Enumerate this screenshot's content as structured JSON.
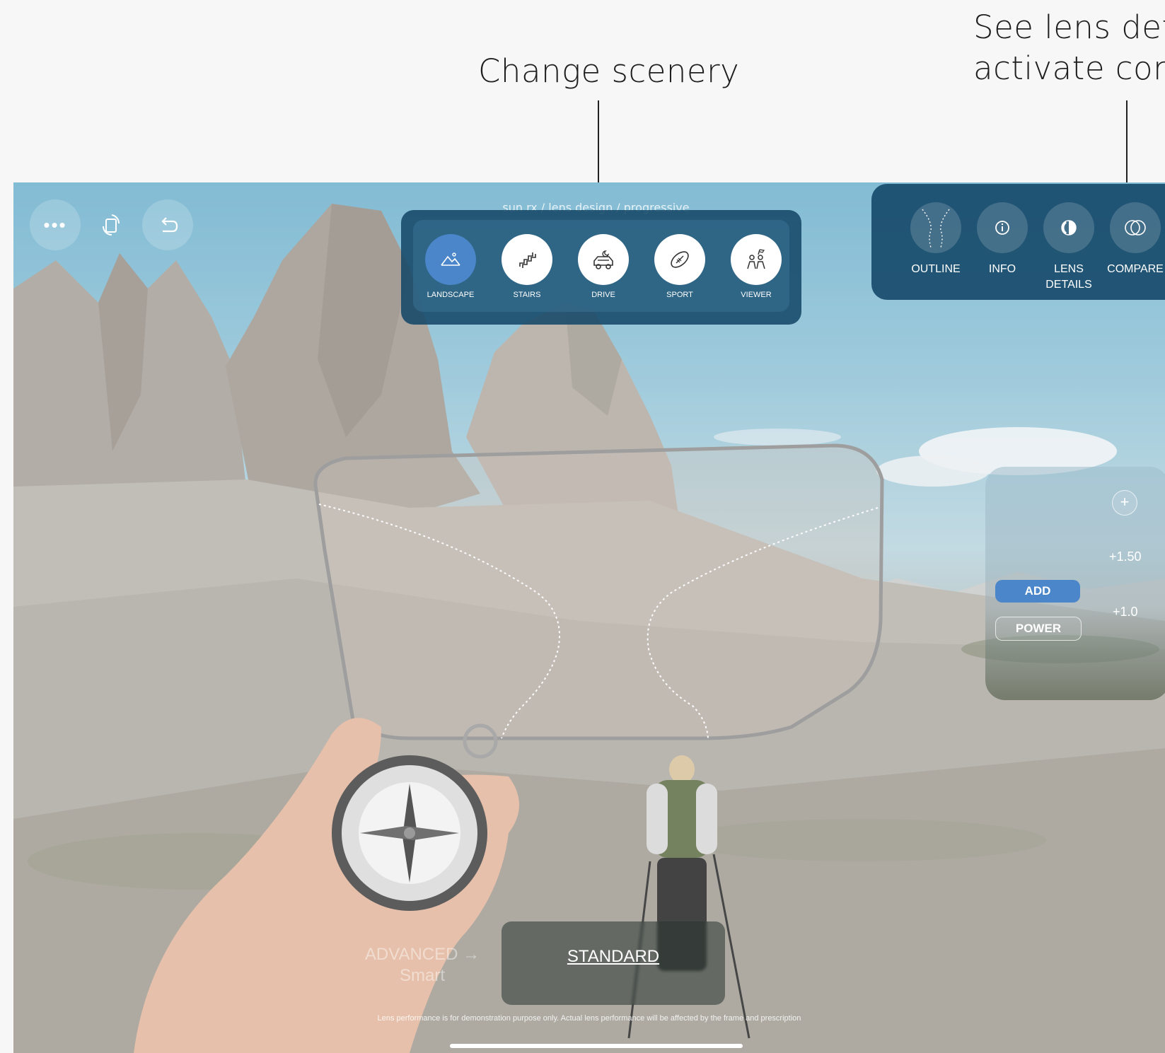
{
  "callouts": {
    "scenery": "Change scenery",
    "lens_line1": "See lens det",
    "lens_line2": "activate com"
  },
  "top_bar": {
    "menu_icon": "more-horizontal-icon",
    "rotate_icon": "rotate-screen-icon",
    "back_icon": "undo-arrow-icon"
  },
  "breadcrumb": "sun rx / lens design / progressive",
  "scenery": {
    "selected": "LANDSCAPE",
    "items": [
      {
        "label": "LANDSCAPE",
        "icon": "mountain-icon"
      },
      {
        "label": "STAIRS",
        "icon": "stairs-icon"
      },
      {
        "label": "DRIVE",
        "icon": "car-icon"
      },
      {
        "label": "SPORT",
        "icon": "football-icon"
      },
      {
        "label": "VIEWER",
        "icon": "people-icon"
      }
    ]
  },
  "lens_tools": {
    "items": [
      {
        "label": "OUTLINE",
        "icon": "outline-icon"
      },
      {
        "label": "INFO",
        "icon": "info-icon"
      },
      {
        "label": "LENS DETAILS",
        "icon": "half-circle-icon"
      },
      {
        "label": "COMPARE",
        "icon": "overlapping-circles-icon"
      }
    ]
  },
  "add_power": {
    "plus_label": "+",
    "value_top": "+1.50",
    "value_bottom": "+1.0",
    "add_label": "ADD",
    "power_label": "POWER"
  },
  "design_mode": {
    "advanced_label": "ADVANCED →",
    "advanced_sub": "Smart",
    "standard_label": "STANDARD"
  },
  "disclaimer": "Lens performance is for demonstration purpose only. Actual lens performance will be affected by the frame and prescription",
  "colors": {
    "panel": "#164868",
    "accent": "#4a86c9",
    "sky": "#6bb1cf"
  }
}
